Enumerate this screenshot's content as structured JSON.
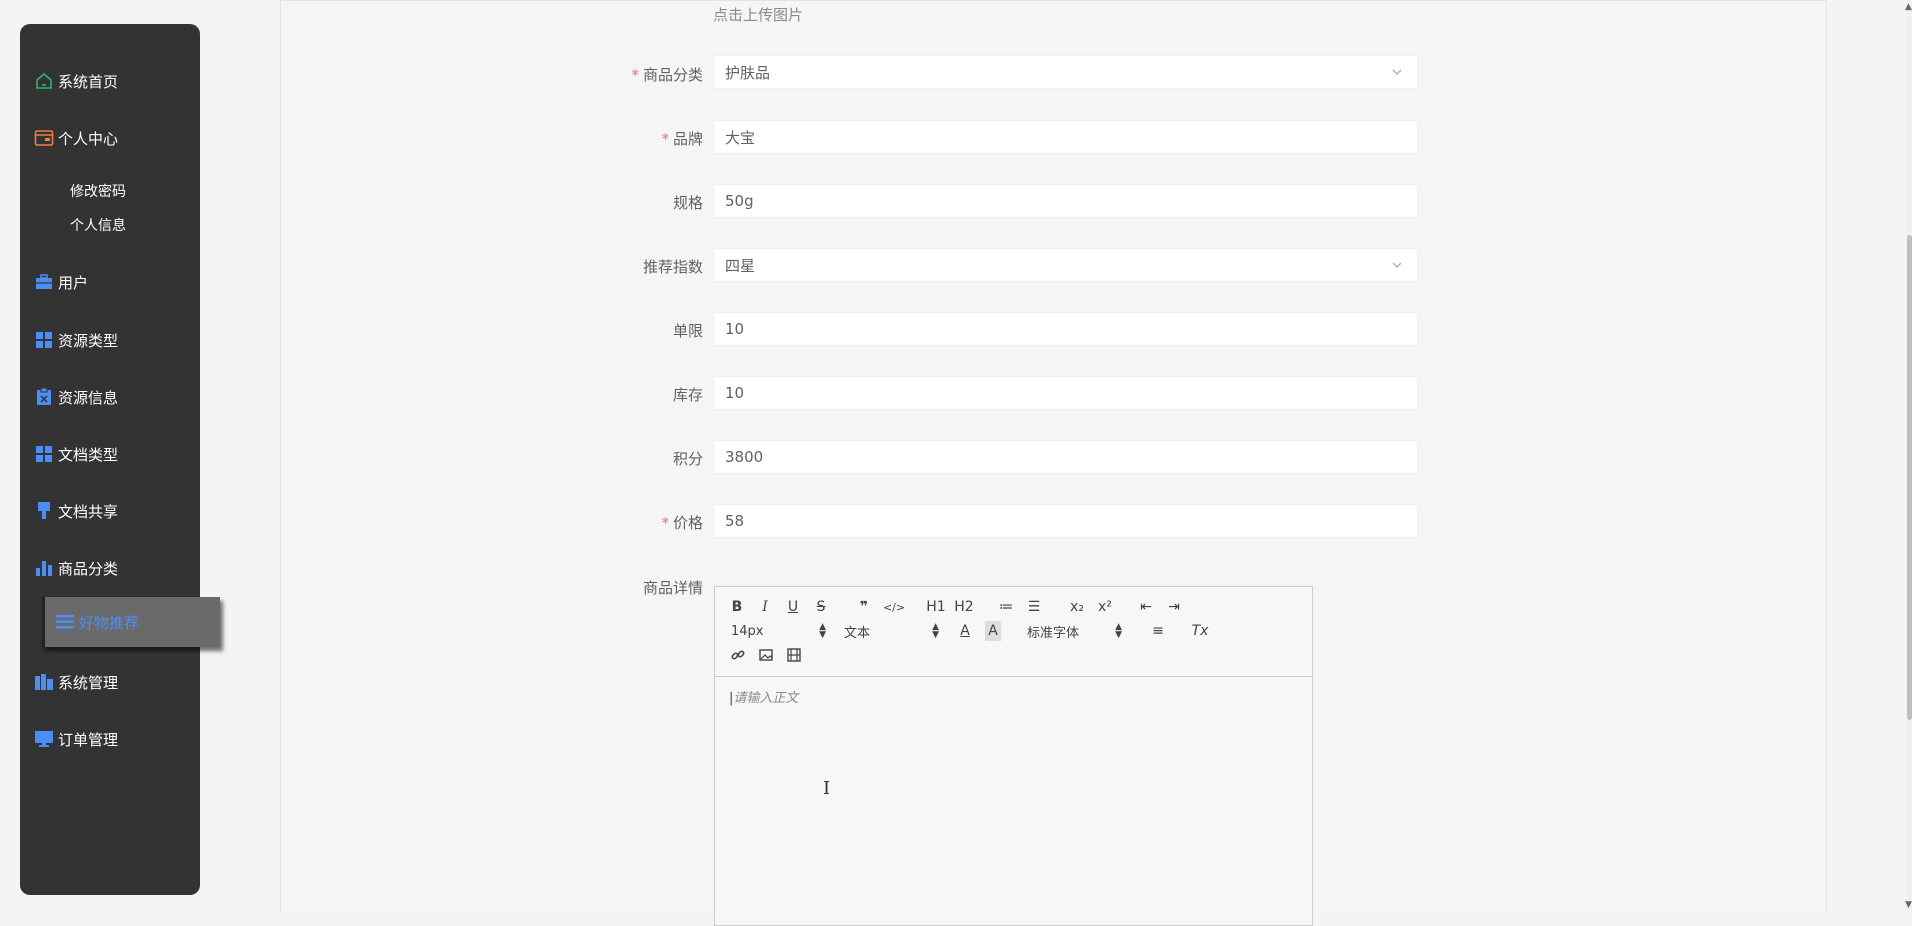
{
  "sidebar": {
    "items": [
      {
        "label": "系统首页",
        "icon": "home-icon"
      },
      {
        "label": "个人中心",
        "icon": "wallet-icon"
      },
      {
        "label": "用户",
        "icon": "briefcase-icon"
      },
      {
        "label": "资源类型",
        "icon": "grid-icon"
      },
      {
        "label": "资源信息",
        "icon": "clipboard-icon"
      },
      {
        "label": "文档类型",
        "icon": "grid-icon"
      },
      {
        "label": "文档共享",
        "icon": "brush-icon"
      },
      {
        "label": "商品分类",
        "icon": "bar-chart-icon"
      },
      {
        "label": "好物推荐",
        "icon": "list-icon"
      },
      {
        "label": "系统管理",
        "icon": "building-icon"
      },
      {
        "label": "订单管理",
        "icon": "monitor-icon"
      }
    ],
    "subitems": [
      "修改密码",
      "个人信息"
    ],
    "active_index": 8,
    "colors": {
      "background": "#333333",
      "icon_blue": "#4a8ef7",
      "home_green": "#2bb673",
      "wallet_orange": "#f07c4a"
    }
  },
  "form": {
    "upload_hint": "点击上传图片",
    "fields": [
      {
        "label": "商品分类",
        "value": "护肤品",
        "required": true,
        "type": "select"
      },
      {
        "label": "品牌",
        "value": "大宝",
        "required": true,
        "type": "input"
      },
      {
        "label": "规格",
        "value": "50g",
        "required": false,
        "type": "input"
      },
      {
        "label": "推荐指数",
        "value": "四星",
        "required": false,
        "type": "select"
      },
      {
        "label": "单限",
        "value": "10",
        "required": false,
        "type": "input"
      },
      {
        "label": "库存",
        "value": "10",
        "required": false,
        "type": "input"
      },
      {
        "label": "积分",
        "value": "3800",
        "required": false,
        "type": "input"
      },
      {
        "label": "价格",
        "value": "58",
        "required": true,
        "type": "input"
      }
    ],
    "required_mark": "*",
    "required_color": "#f56c6c"
  },
  "editor": {
    "label": "商品详情",
    "font_size": "14px",
    "header": "文本",
    "font": "标准字体",
    "placeholder": "请输入正文",
    "buttons": {
      "bold": "B",
      "italic": "I",
      "underline": "U",
      "strike": "S",
      "quote": "❞",
      "code": "</>",
      "h1": "H1",
      "h2": "H2",
      "ordered_list": "≔",
      "bullet_list": "☰",
      "sub": "x₂",
      "sup": "x²",
      "outdent": "⇤",
      "indent": "⇥",
      "color": "A",
      "background": "A",
      "align": "≡",
      "clean": "Tx"
    }
  }
}
